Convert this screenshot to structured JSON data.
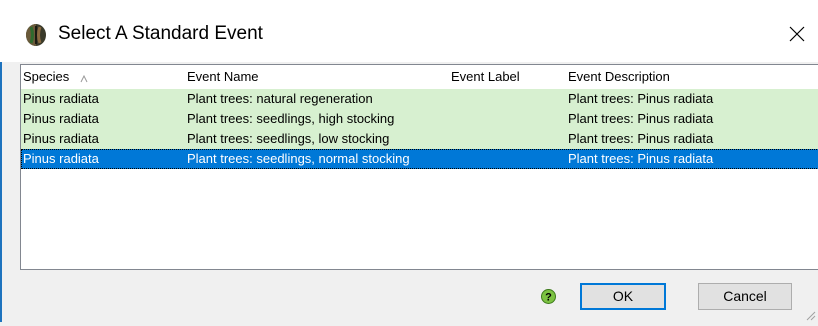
{
  "window": {
    "title": "Select A Standard Event",
    "app_icon": "mixed-tree-icon",
    "close_icon": "close-icon"
  },
  "list": {
    "columns": [
      "Species",
      "Event Name",
      "Event Label",
      "Event Description"
    ],
    "sorted_column": "Species",
    "rows": [
      {
        "species": "Pinus radiata",
        "event_name": "Plant trees: natural regeneration",
        "event_label": "",
        "event_description": "Plant trees: Pinus radiata",
        "selected": false
      },
      {
        "species": "Pinus radiata",
        "event_name": "Plant trees: seedlings, high stocking",
        "event_label": "",
        "event_description": "Plant trees: Pinus radiata",
        "selected": false
      },
      {
        "species": "Pinus radiata",
        "event_name": "Plant trees: seedlings, low stocking",
        "event_label": "",
        "event_description": "Plant trees: Pinus radiata",
        "selected": false
      },
      {
        "species": "Pinus radiata",
        "event_name": "Plant trees: seedlings, normal stocking",
        "event_label": "",
        "event_description": "Plant trees: Pinus radiata",
        "selected": true
      }
    ]
  },
  "buttons": {
    "ok_label": "OK",
    "cancel_label": "Cancel",
    "help_icon": "help-icon"
  },
  "colors": {
    "row_highlight": "#d7f0d0",
    "selection": "#0078d7",
    "accent": "#1e73be"
  }
}
